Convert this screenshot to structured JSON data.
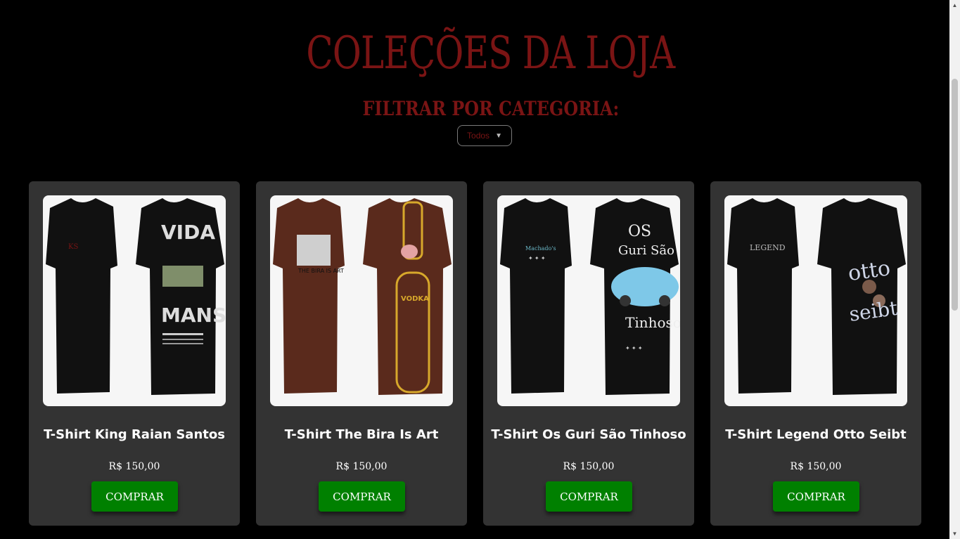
{
  "header": {
    "title": "Coleções da Loja",
    "filter_label": "Filtrar por categoria:",
    "filter_value": "Todos"
  },
  "products": [
    {
      "name": "T-Shirt King Raian Santos",
      "price": "R$ 150,00",
      "button": "COMPRAR",
      "shirt_color": "#111111",
      "back_print": "VIDA MANSA",
      "front_print": "KS"
    },
    {
      "name": "T-Shirt The Bira Is Art",
      "price": "R$ 150,00",
      "button": "COMPRAR",
      "shirt_color": "#5a2a1c",
      "back_print": "VODKA",
      "front_print": "THE BIRA IS ART"
    },
    {
      "name": "T-Shirt Os Guri São Tinhoso",
      "price": "R$ 150,00",
      "button": "COMPRAR",
      "shirt_color": "#111111",
      "back_print": "OS Guri São Tinhoso",
      "front_print": "Machado's"
    },
    {
      "name": "T-Shirt Legend Otto Seibt",
      "price": "R$ 150,00",
      "button": "COMPRAR",
      "shirt_color": "#111111",
      "back_print": "otto seibt",
      "front_print": "LEGEND"
    }
  ],
  "colors": {
    "accent": "#7a1414",
    "card_bg": "#333333",
    "button_bg": "#008000"
  }
}
